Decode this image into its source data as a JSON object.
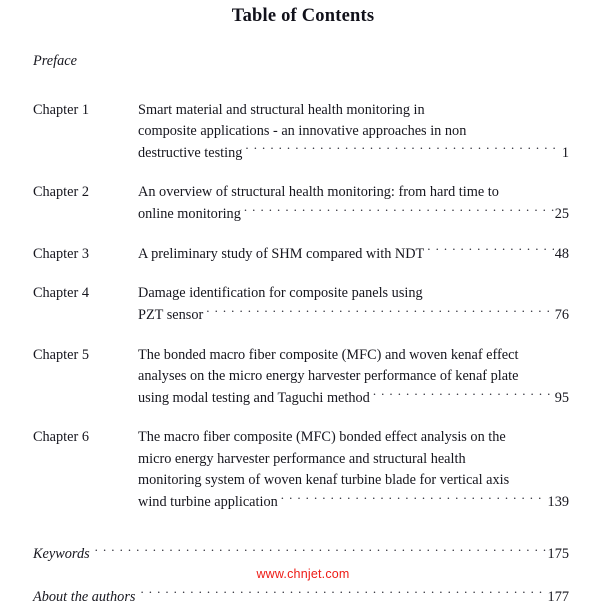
{
  "document": {
    "title": "Table of Contents",
    "preface_label": "Preface"
  },
  "entries": [
    {
      "label": "Chapter 1",
      "lines": [
        "Smart material and structural health monitoring in",
        "composite applications - an innovative approaches in non"
      ],
      "last_line": "destructive testing",
      "page": "1"
    },
    {
      "label": "Chapter 2",
      "lines": [
        "An overview of structural health monitoring: from hard time to"
      ],
      "last_line": "online monitoring",
      "page": "25"
    },
    {
      "label": "Chapter 3",
      "lines": [],
      "last_line": "A preliminary study of SHM compared with NDT",
      "page": "48"
    },
    {
      "label": "Chapter 4",
      "lines": [
        "Damage identification for composite panels using"
      ],
      "last_line": "PZT sensor",
      "page": "76"
    },
    {
      "label": "Chapter 5",
      "lines": [
        "The bonded macro fiber composite (MFC) and woven kenaf effect",
        "analyses on the micro energy harvester performance of kenaf plate"
      ],
      "last_line": "using modal testing and Taguchi method",
      "page": "95"
    },
    {
      "label": "Chapter 6",
      "lines": [
        "The macro fiber composite (MFC) bonded effect analysis on the",
        "micro energy harvester performance and structural health",
        "monitoring system of woven kenaf turbine blade for vertical axis"
      ],
      "last_line": "wind turbine application",
      "page": "139"
    }
  ],
  "backmatter": [
    {
      "label": "Keywords",
      "page": "175"
    },
    {
      "label": "About the authors",
      "page": "177"
    }
  ],
  "watermark": {
    "text": "www.chnjet.com",
    "color": "#ee1b15"
  }
}
